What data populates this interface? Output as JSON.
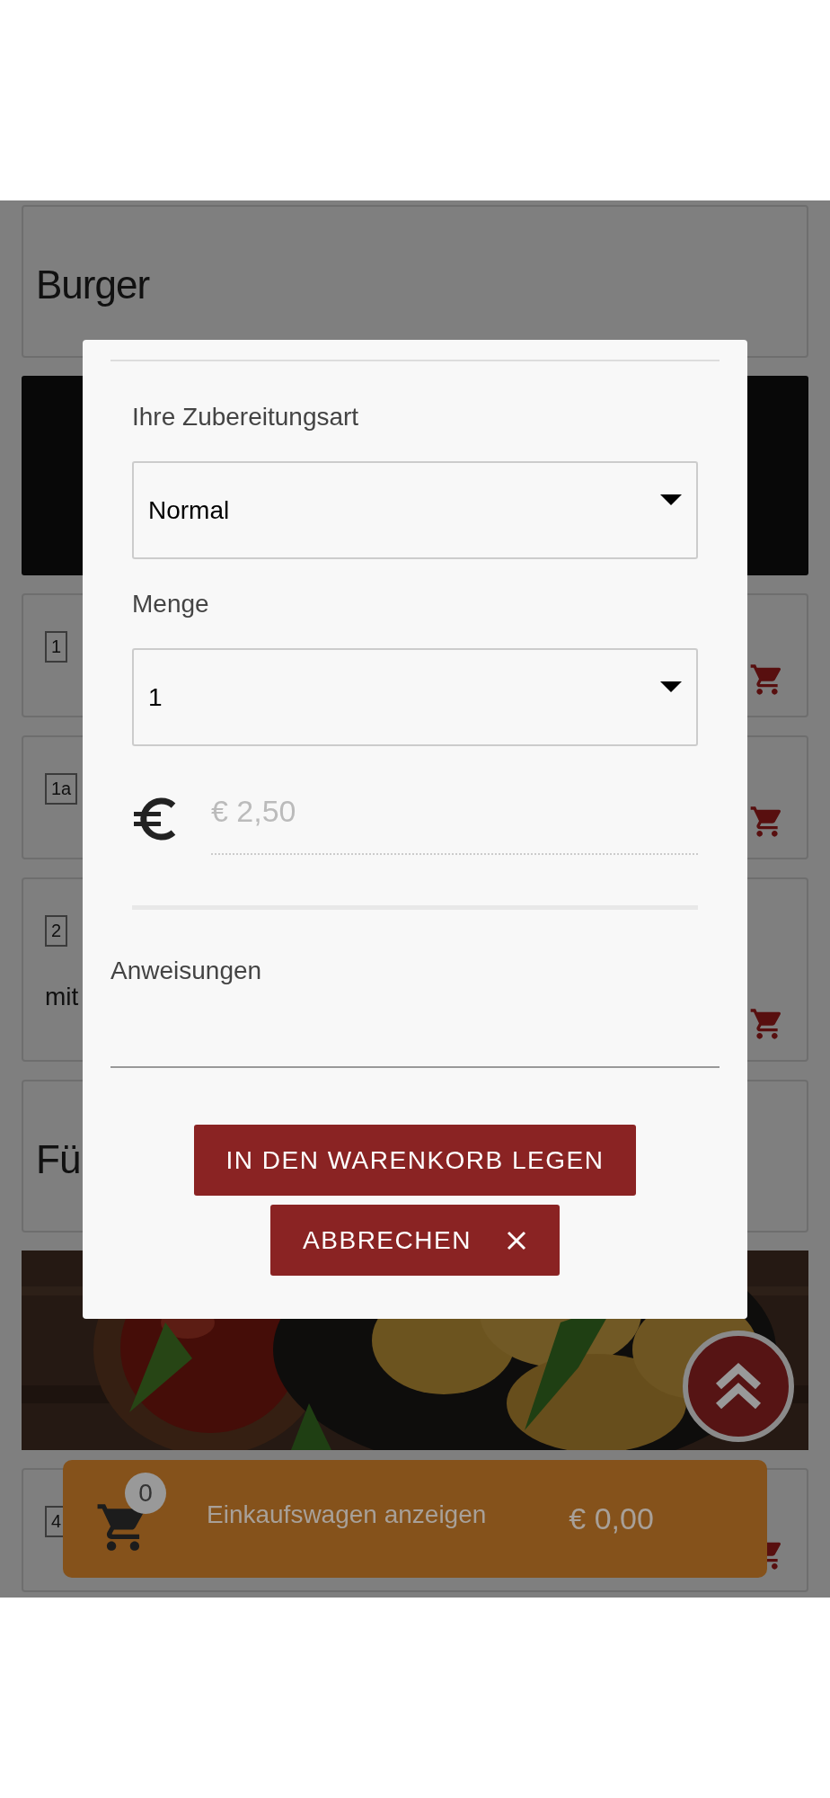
{
  "page": {
    "sections": [
      {
        "kind": "heading",
        "title": "Burger"
      },
      {
        "kind": "banner"
      },
      {
        "kind": "item",
        "number": "1"
      },
      {
        "kind": "item",
        "number": "1a"
      },
      {
        "kind": "item",
        "number": "2",
        "description": "mit"
      },
      {
        "kind": "heading",
        "title": "Fü"
      },
      {
        "kind": "picture"
      },
      {
        "kind": "item",
        "number": "4"
      }
    ]
  },
  "modal": {
    "fields": [
      {
        "kind": "select",
        "label": "Ihre Zubereitungsart",
        "value": "Normal"
      },
      {
        "kind": "select",
        "label": "Menge",
        "value": "1"
      },
      {
        "kind": "price",
        "value": "€ 2,50",
        "disabled": true
      },
      {
        "kind": "textarea",
        "label": "Anweisungen"
      }
    ],
    "buttons": [
      {
        "kind": "add",
        "label": "IN DEN WARENKORB LEGEN"
      },
      {
        "kind": "cancel",
        "label": "ABBRECHEN"
      }
    ]
  },
  "cart_bar": {
    "count": "0",
    "label": "Einkaufswagen anzeigen",
    "total": "€ 0,00"
  }
}
